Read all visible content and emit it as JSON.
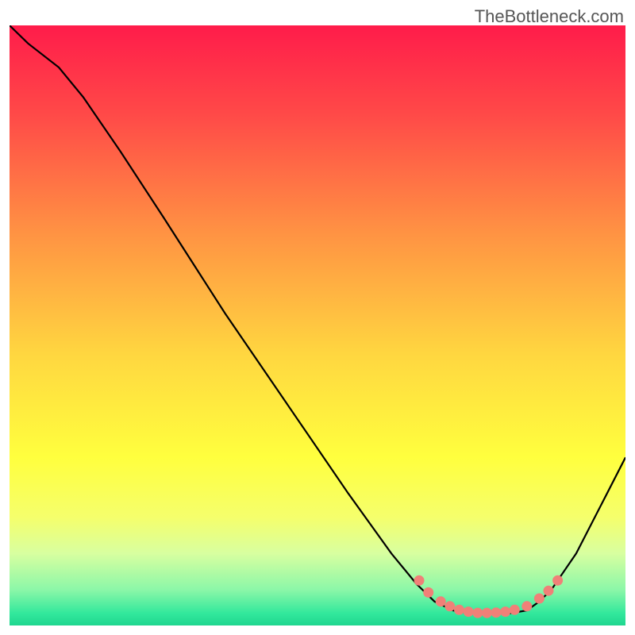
{
  "attribution": "TheBottleneck.com",
  "chart_data": {
    "type": "line",
    "title": "",
    "xlabel": "",
    "ylabel": "",
    "x_range": [
      0,
      100
    ],
    "y_range": [
      0,
      100
    ],
    "curve_points": [
      {
        "x": 0,
        "y": 100
      },
      {
        "x": 3,
        "y": 97
      },
      {
        "x": 8,
        "y": 93
      },
      {
        "x": 12,
        "y": 88
      },
      {
        "x": 18,
        "y": 79
      },
      {
        "x": 25,
        "y": 68
      },
      {
        "x": 35,
        "y": 52
      },
      {
        "x": 45,
        "y": 37
      },
      {
        "x": 55,
        "y": 22
      },
      {
        "x": 62,
        "y": 12
      },
      {
        "x": 66,
        "y": 7
      },
      {
        "x": 69,
        "y": 4
      },
      {
        "x": 72,
        "y": 2.5
      },
      {
        "x": 75,
        "y": 2
      },
      {
        "x": 78,
        "y": 2
      },
      {
        "x": 81,
        "y": 2
      },
      {
        "x": 84,
        "y": 2.5
      },
      {
        "x": 86,
        "y": 4
      },
      {
        "x": 88,
        "y": 6
      },
      {
        "x": 92,
        "y": 12
      },
      {
        "x": 96,
        "y": 20
      },
      {
        "x": 100,
        "y": 28
      }
    ],
    "highlight_dots": [
      {
        "x": 66.5,
        "y": 7.5
      },
      {
        "x": 68,
        "y": 5.5
      },
      {
        "x": 70,
        "y": 4
      },
      {
        "x": 71.5,
        "y": 3.2
      },
      {
        "x": 73,
        "y": 2.6
      },
      {
        "x": 74.5,
        "y": 2.3
      },
      {
        "x": 76,
        "y": 2.1
      },
      {
        "x": 77.5,
        "y": 2.1
      },
      {
        "x": 79,
        "y": 2.15
      },
      {
        "x": 80.5,
        "y": 2.3
      },
      {
        "x": 82,
        "y": 2.6
      },
      {
        "x": 84,
        "y": 3.2
      },
      {
        "x": 86,
        "y": 4.5
      },
      {
        "x": 87.5,
        "y": 5.8
      },
      {
        "x": 89,
        "y": 7.5
      }
    ],
    "gradient_stops": [
      {
        "offset": 0,
        "color": "#ff1c4a"
      },
      {
        "offset": 0.15,
        "color": "#ff4a48"
      },
      {
        "offset": 0.35,
        "color": "#ff9443"
      },
      {
        "offset": 0.55,
        "color": "#ffd740"
      },
      {
        "offset": 0.72,
        "color": "#ffff3e"
      },
      {
        "offset": 0.82,
        "color": "#f5ff6c"
      },
      {
        "offset": 0.88,
        "color": "#d8ffa0"
      },
      {
        "offset": 0.94,
        "color": "#8cf7a8"
      },
      {
        "offset": 0.98,
        "color": "#32e89c"
      },
      {
        "offset": 1.0,
        "color": "#1fd68f"
      }
    ]
  }
}
